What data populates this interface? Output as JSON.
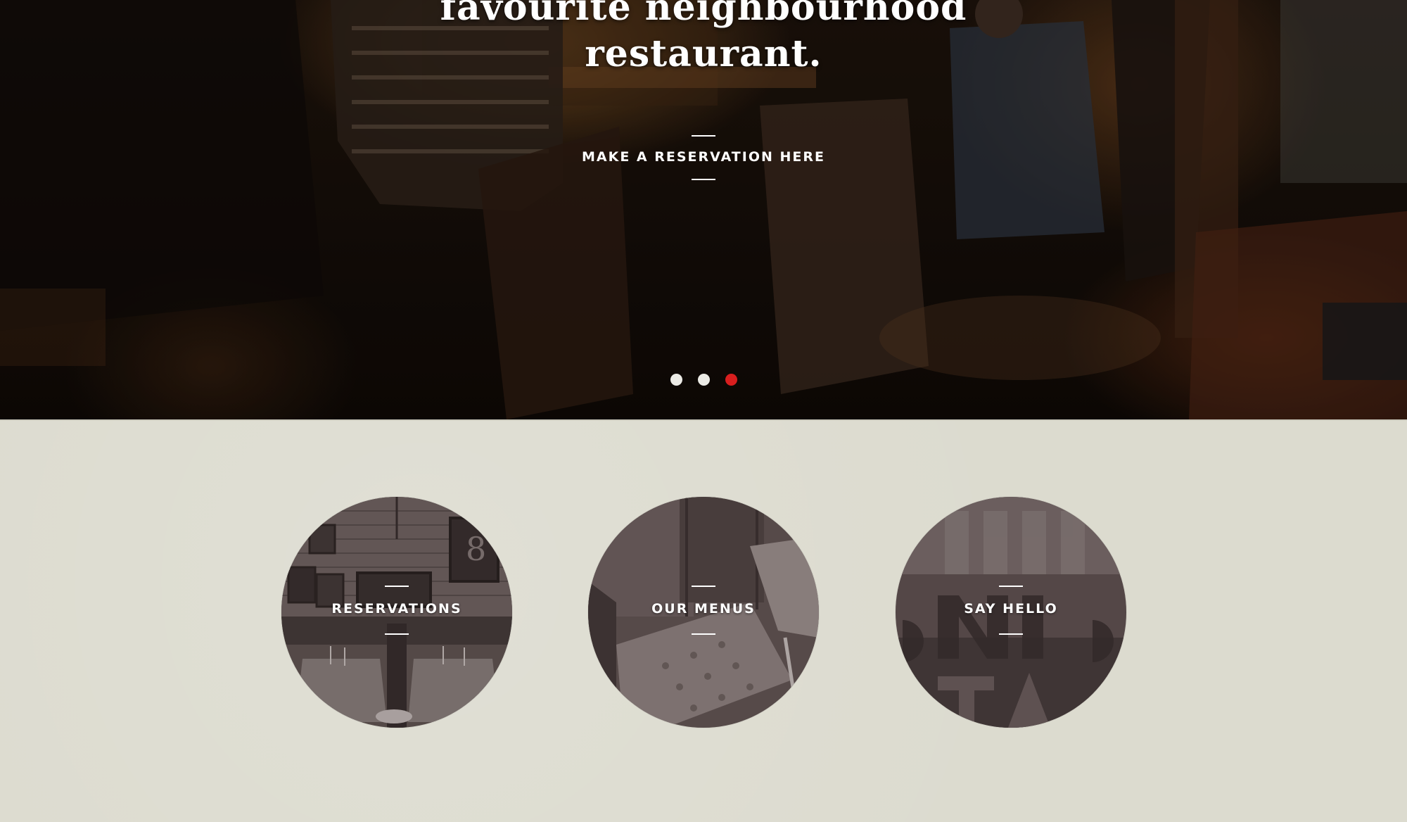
{
  "hero": {
    "headline_line1": "favourite neighbourhood",
    "headline_line2": "restaurant.",
    "cta_label": "MAKE A RESERVATION HERE",
    "slider": {
      "total_slides": 3,
      "active_slide": 3,
      "active_color": "#d81e1e",
      "inactive_color": "#ecebe6"
    }
  },
  "tiles": [
    {
      "label": "RESERVATIONS",
      "image": "restaurant-dining-room-photo"
    },
    {
      "label": "OUR MENUS",
      "image": "tufted-leather-chair-photo"
    },
    {
      "label": "SAY HELLO",
      "image": "signage-lettering-photo"
    }
  ],
  "colors": {
    "panel_background": "#dcdbcf",
    "text": "#ffffff"
  }
}
